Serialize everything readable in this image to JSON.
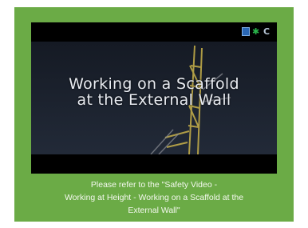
{
  "video": {
    "title_line1": "Working on a Scaffold",
    "title_line2": "at the External Wall",
    "logos": [
      "blue-square-logo",
      "green-flower-logo",
      "grey-c-logo"
    ]
  },
  "caption": {
    "line1": "Please refer to the \"Safety Video -",
    "line2": "Working at Height - Working on a Scaffold at the",
    "line3": "External Wall\""
  },
  "colors": {
    "card_background": "#6bab46",
    "video_background": "#1a1f29",
    "caption_text": "#f4f8ef"
  }
}
